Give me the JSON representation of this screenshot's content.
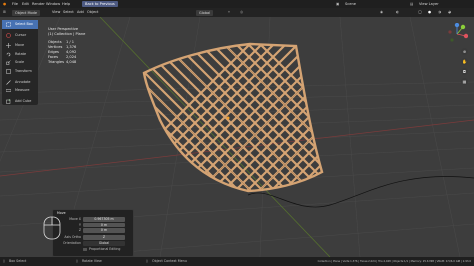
{
  "app": {
    "menus": [
      "File",
      "Edit",
      "Render",
      "Window",
      "Help"
    ],
    "back_button": "Back to Previous",
    "scene_label": "Scene",
    "view_layer_label": "View Layer"
  },
  "viewport_header": {
    "mode": "Object Mode",
    "menus": [
      "View",
      "Select",
      "Add",
      "Object"
    ],
    "transform_orientation": "Global"
  },
  "toolbar": {
    "items": [
      {
        "label": "Select Box",
        "icon": "select-box-icon",
        "active": true
      },
      {
        "label": "Cursor",
        "icon": "cursor-icon",
        "active": false
      },
      {
        "label": "Move",
        "icon": "move-icon",
        "active": false
      },
      {
        "label": "Rotate",
        "icon": "rotate-icon",
        "active": false
      },
      {
        "label": "Scale",
        "icon": "scale-icon",
        "active": false
      },
      {
        "label": "Transform",
        "icon": "transform-icon",
        "active": false
      },
      {
        "label": "Annotate",
        "icon": "annotate-icon",
        "active": false
      },
      {
        "label": "Measure",
        "icon": "measure-icon",
        "active": false
      },
      {
        "label": "Add Cube",
        "icon": "add-cube-icon",
        "active": false
      }
    ]
  },
  "overlay": {
    "title": "User Perspective",
    "collection": "(1) Collection | Plane",
    "stats": [
      {
        "k": "Objects",
        "v": "1 / 1"
      },
      {
        "k": "Vertices",
        "v": "1,376"
      },
      {
        "k": "Edges",
        "v": "4,092"
      },
      {
        "k": "Faces",
        "v": "2,024"
      },
      {
        "k": "Triangles",
        "v": "4,048"
      }
    ]
  },
  "operator_panel": {
    "title": "Move",
    "move_x": "0.967305 m",
    "move_y": "0 m",
    "move_z": "0 m",
    "axis_ortho": "Z",
    "orientation": "Global",
    "proportional": "Proportional Editing"
  },
  "statusbar": {
    "left": "Box Select",
    "middle": "Rotate View",
    "center": "Object Context Menu",
    "right": "Collection | Plane | Verts:1,376 | Faces:2,024 | Tris:4,048 | Objects:1/1 | Memory: 25.6 MiB | VRAM: 0.5/6.0 GiB | 2.93.0"
  },
  "colors": {
    "accent": "#4772b3",
    "mesh": "#d4a373",
    "x_axis": "#e0535e",
    "y_axis": "#8ccf3a",
    "z_axis": "#4c8ce0"
  }
}
